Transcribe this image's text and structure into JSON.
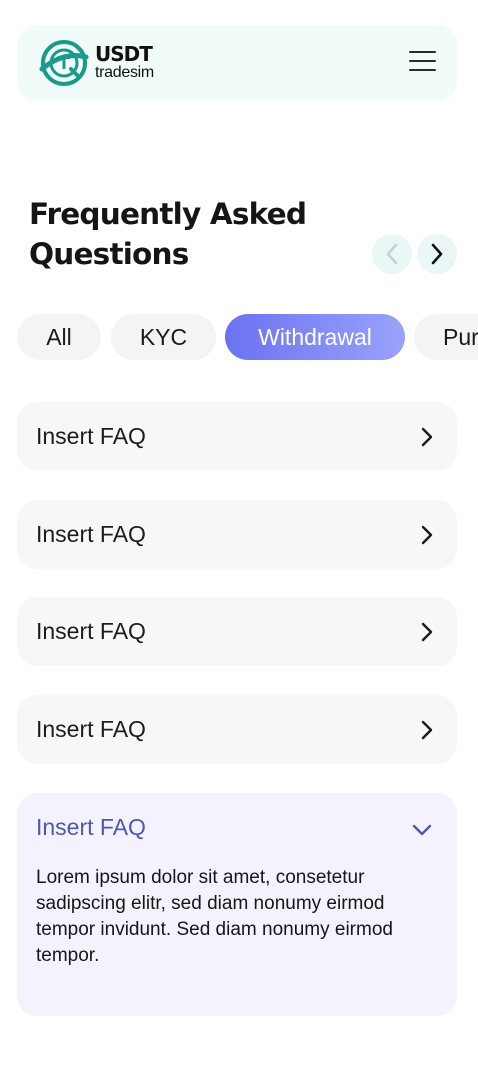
{
  "header": {
    "logo_usdt": "USDT",
    "logo_tradesim": "tradesim",
    "menu_icon": "hamburger-menu-icon",
    "brand_color": "#1a9b8a"
  },
  "page": {
    "title_line1": "Frequently Asked",
    "title_line2": "Questions",
    "prev_icon": "chevron-left-icon",
    "next_icon": "chevron-right-icon"
  },
  "categories": [
    {
      "label": "All",
      "active": false
    },
    {
      "label": "KYC",
      "active": false
    },
    {
      "label": "Withdrawal",
      "active": true
    },
    {
      "label": "Pur",
      "active": false
    }
  ],
  "faqs": [
    {
      "question": "Insert FAQ",
      "expanded": false
    },
    {
      "question": "Insert FAQ",
      "expanded": false
    },
    {
      "question": "Insert FAQ",
      "expanded": false
    },
    {
      "question": "Insert FAQ",
      "expanded": false
    },
    {
      "question": "Insert FAQ",
      "expanded": true,
      "answer": "Lorem ipsum dolor sit amet, consetetur sadipscing elitr, sed diam nonumy eirmod tempor invidunt. Sed diam nonumy eirmod tempor."
    }
  ],
  "colors": {
    "accent_gradient_start": "#6b72f1",
    "accent_gradient_end": "#9aa2fb",
    "expanded_question": "#5156b0",
    "header_bg": "#f0fbfa"
  }
}
